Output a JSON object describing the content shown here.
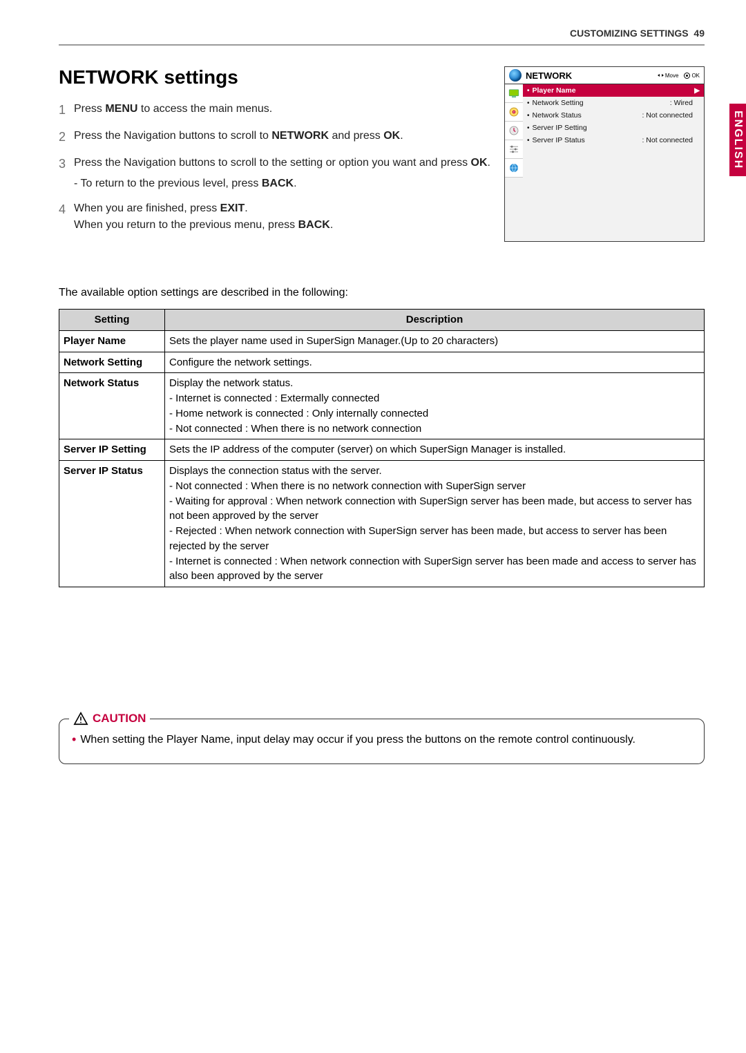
{
  "header": {
    "label": "CUSTOMIZING SETTINGS",
    "page": "49"
  },
  "lang_tab": "ENGLISH",
  "title": "NETWORK settings",
  "steps": [
    {
      "n": "1",
      "html": "Press <b>MENU</b> to access the main menus."
    },
    {
      "n": "2",
      "html": "Press the Navigation buttons to scroll to <b>NETWORK</b> and press <b>OK</b>."
    },
    {
      "n": "3",
      "html": "Press the Navigation buttons to scroll to the setting or option you want and press <b>OK</b>.",
      "sub": "- To return to the previous level, press <b>BACK</b>."
    },
    {
      "n": "4",
      "html": "When you are finished, press <b>EXIT</b>.<br>When you return to the previous menu, press <b>BACK</b>."
    }
  ],
  "osd": {
    "title": "NETWORK",
    "move_label": "Move",
    "ok_label": "OK",
    "selected": "Player Name",
    "rows": [
      {
        "label": "Network Setting",
        "value": ": Wired"
      },
      {
        "label": "Network Status",
        "value": ": Not connected"
      },
      {
        "label": "Server IP Setting",
        "value": ""
      },
      {
        "label": "Server IP Status",
        "value": ": Not connected"
      }
    ],
    "side_icons": [
      "screen-icon",
      "disc-icon",
      "clock-icon",
      "sliders-icon",
      "globe-icon"
    ]
  },
  "intro": "The available option settings are described in the following:",
  "table": {
    "head_setting": "Setting",
    "head_desc": "Description",
    "rows": [
      {
        "k": "Player Name",
        "d": "Sets the player name used in SuperSign Manager.(Up to 20 characters)"
      },
      {
        "k": "Network Setting",
        "d": "Configure the network settings."
      },
      {
        "k": "Network Status",
        "d": "Display the network status.\n- Internet is connected : Extermally connected\n- Home network is connected : Only internally connected\n- Not connected : When there is no network connection"
      },
      {
        "k": "Server IP Setting",
        "d": "Sets the IP address of the computer (server) on which SuperSign Manager is installed."
      },
      {
        "k": "Server IP Status",
        "d": "Displays the connection status with the server.\n- Not connected : When there is no network connection with SuperSign server\n- Waiting for approval : When network connection with SuperSign server has been made, but access to server has not been approved by the server\n- Rejected : When network connection with SuperSign server has been made, but access to server has been rejected by the server\n- Internet is connected : When network connection with SuperSign server has been made and access to server has also been approved by the server"
      }
    ]
  },
  "caution": {
    "label": "CAUTION",
    "text": "When setting the Player Name, input delay may occur if you press the buttons on the remote control continuously."
  }
}
